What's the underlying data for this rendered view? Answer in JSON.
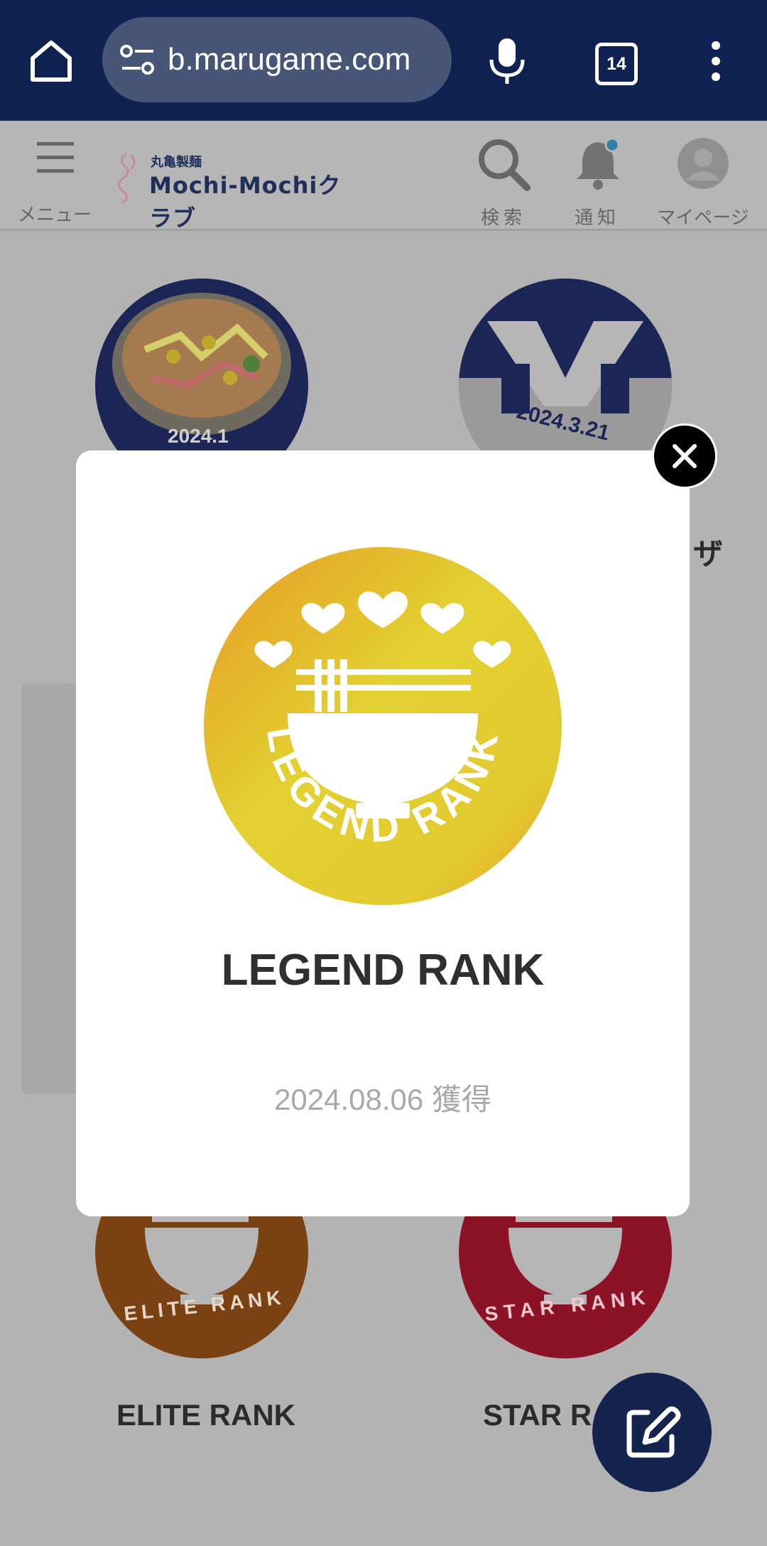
{
  "browser": {
    "url": "b.marugame.com",
    "tab_count": "14"
  },
  "header": {
    "menu_label": "メニュー",
    "logo_jp": "丸亀製麺",
    "logo_en": "Mochi-Mochiクラブ",
    "search_label": "検索",
    "notify_label": "通知",
    "mypage_label": "マイページ"
  },
  "background_badges": {
    "badge1_date": "2024.1",
    "badge2_date": "2024.3.21",
    "badge2_partial_title": "ザ",
    "elite_label": "ELITE RANK",
    "elite_ring_text": "ELITE RANK",
    "star_label": "STAR RA",
    "star_ring_text": "STAR RANK"
  },
  "modal": {
    "title": "LEGEND RANK",
    "ring_text": "LEGEND RANK",
    "date": "2024.08.06 獲得"
  },
  "colors": {
    "chrome_bar": "#0f2150",
    "navy": "#14244f",
    "legend_gold": "#e2c92f",
    "elite_brown": "#8a4a12",
    "star_red": "#a3142a"
  }
}
